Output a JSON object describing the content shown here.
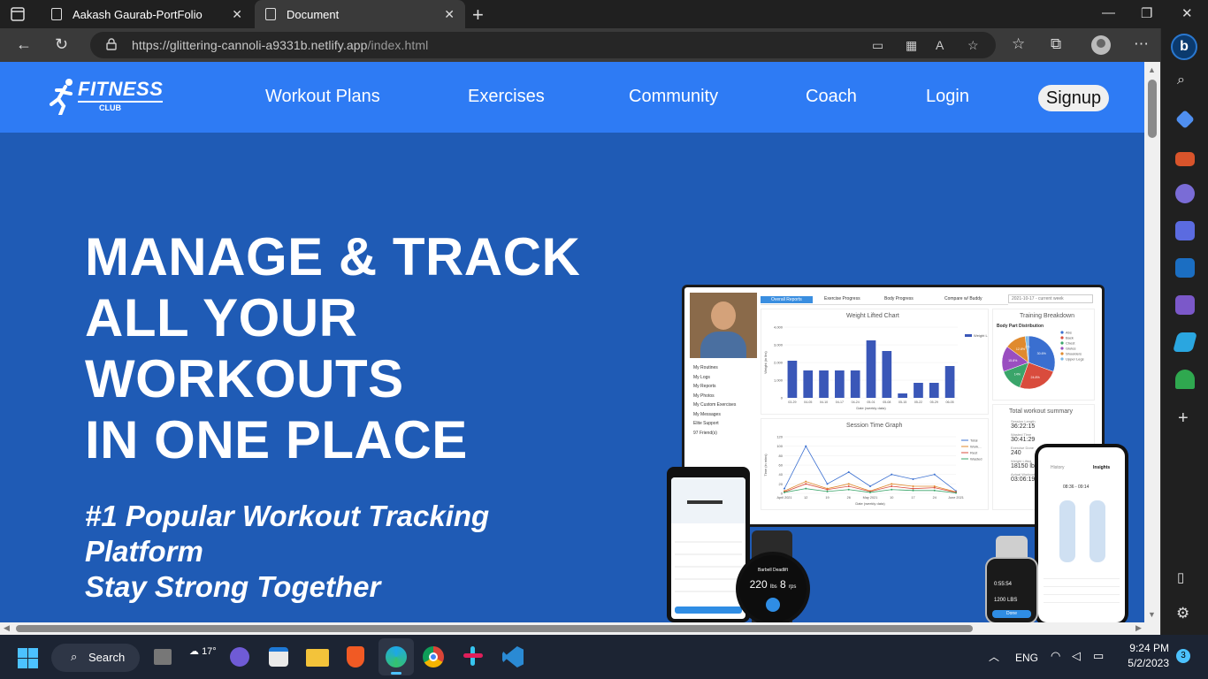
{
  "browser": {
    "tabs": [
      {
        "title": "Aakash Gaurab-PortFolio",
        "active": false
      },
      {
        "title": "Document",
        "active": true
      }
    ],
    "url": {
      "host": "https://glittering-cannoli-a9331b.netlify.app",
      "path": "/index.html"
    }
  },
  "site": {
    "logo": {
      "main": "FITNESS",
      "sub": "CLUB"
    },
    "nav": [
      "Workout Plans",
      "Exercises",
      "Community",
      "Coach",
      "Login"
    ],
    "signup": "Signup",
    "hero": {
      "title_lines": [
        "MANAGE & TRACK",
        "ALL YOUR",
        "WORKOUTS",
        "IN ONE PLACE"
      ],
      "sub_lines": [
        "#1 Popular Workout Tracking",
        "Platform",
        "Stay Strong Together"
      ]
    }
  },
  "mockup": {
    "tabs": [
      "Overall Reports",
      "Exercise Progress",
      "Body Progress",
      "Compare w/ Buddy"
    ],
    "week_select": "2021-10-17 - current week",
    "weight_chart_title": "Weight Lifted Chart",
    "training_title": "Training Breakdown",
    "session_title": "Session Time Graph",
    "summary_title": "Total workout summary",
    "menu": [
      "My Routines",
      "My Logs",
      "My Reports",
      "My Photos",
      "My Custom Exercises",
      "My Messages",
      "Elite Support",
      "97 Friend(s)"
    ],
    "summary": [
      {
        "label": "Session Length",
        "value": "36:22:15"
      },
      {
        "label": "Wasted Time",
        "value": "30:41:29"
      },
      {
        "label": "Exercise Done",
        "value": "240"
      },
      {
        "label": "Weight Lifted",
        "value": "18150 lbs"
      },
      {
        "label": "Actual Workout",
        "value": "03:06:19"
      }
    ],
    "watch_reading": {
      "weight": "220",
      "unit": "lbs",
      "reps": "8",
      "reps_unit": "rps",
      "exercise": "Barbell Deadlift"
    },
    "phone_tabs": [
      "History",
      "Insights"
    ],
    "phone_time": "08:36 - 09:14",
    "small_watch": {
      "time": "0:55:54",
      "weight": "1200 LBS",
      "button": "Done"
    }
  },
  "taskbar": {
    "search": "Search",
    "weather_temp": "17°",
    "lang": "ENG",
    "time": "9:24 PM",
    "date": "5/2/2023",
    "notifications": "3"
  },
  "colors": {
    "nav_blue": "#2e7bf4",
    "hero_blue": "#1f5bb5",
    "chrome_dark": "#202020"
  },
  "chart_data": [
    {
      "type": "bar",
      "title": "Weight Lifted Chart",
      "xlabel": "Date (weekly data)",
      "ylabel": "Weight (in lbs)",
      "categories": [
        "03-29",
        "04-05",
        "04-10",
        "04-17",
        "04-24",
        "05-01",
        "05-08",
        "05-15",
        "05-22",
        "05-29",
        "06-05"
      ],
      "values": [
        2100,
        1550,
        1550,
        1550,
        1550,
        3250,
        2650,
        250,
        850,
        850,
        1800
      ],
      "ylim": [
        0,
        4000
      ],
      "legend": [
        "Weight Lifted"
      ]
    },
    {
      "type": "pie",
      "title": "Body Part Distribution",
      "categories": [
        "Abs",
        "Back",
        "Chest",
        "Glutes",
        "Shoulders",
        "Upper Legs"
      ],
      "values": [
        30.6,
        24.8,
        14,
        15.8,
        12.8,
        2
      ]
    },
    {
      "type": "line",
      "title": "Session Time Graph",
      "xlabel": "Date (weekly data)",
      "ylabel": "Time (in mins)",
      "categories": [
        "April 2021",
        "12",
        "19",
        "26",
        "May 2021",
        "10",
        "17",
        "24",
        "June 2021"
      ],
      "series": [
        {
          "name": "Total",
          "values": [
            10,
            100,
            20,
            45,
            15,
            40,
            30,
            40,
            5
          ]
        },
        {
          "name": "Work...",
          "values": [
            5,
            25,
            10,
            20,
            5,
            20,
            15,
            15,
            3
          ]
        },
        {
          "name": "Rest",
          "values": [
            3,
            20,
            8,
            15,
            4,
            15,
            10,
            12,
            2
          ]
        },
        {
          "name": "Wasted",
          "values": [
            2,
            10,
            4,
            8,
            2,
            8,
            6,
            6,
            1
          ]
        }
      ]
    }
  ]
}
